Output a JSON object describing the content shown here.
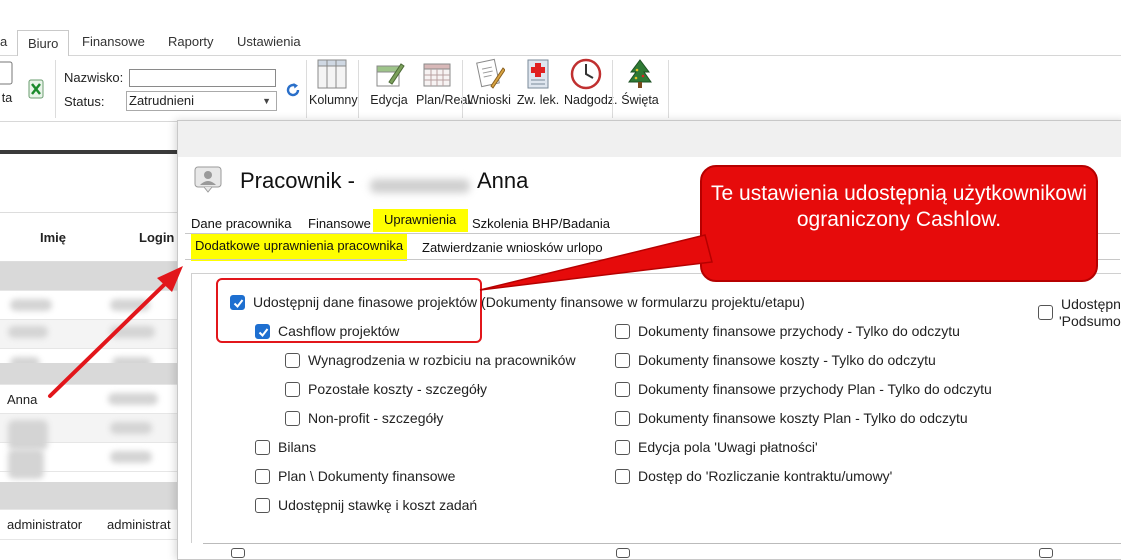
{
  "ribbon": {
    "tabs": [
      "a",
      "Biuro",
      "Finansowe",
      "Raporty",
      "Ustawienia"
    ],
    "active_tab": "Biuro",
    "left_partial_label": "ta",
    "nazwisko_label": "Nazwisko:",
    "nazwisko_value": "",
    "status_label": "Status:",
    "status_value": "Zatrudnieni",
    "buttons": {
      "kolumny": "Kolumny",
      "edycja": "Edycja",
      "plan_real": "Plan/Real.",
      "wnioski": "Wnioski",
      "zw_lek": "Zw. lek.",
      "nadgodz": "Nadgodz.",
      "swieta": "Święta"
    }
  },
  "grid": {
    "columns": [
      "Imię",
      "Login"
    ],
    "visible_cells": {
      "anna": "Anna",
      "admin_1": "administrator",
      "admin_2": "administrat"
    }
  },
  "dialog": {
    "title_prefix": "Pracownik -",
    "title_name": "Anna",
    "tabs": [
      "Dane pracownika",
      "Finansowe",
      "Uprawnienia",
      "Szkolenia BHP/Badania"
    ],
    "active_tab": "Uprawnienia",
    "subtabs": [
      "Dodatkowe uprawnienia pracownika",
      "Zatwierdzanie wniosków urlopo"
    ],
    "active_subtab": "Dodatkowe uprawnienia pracownika",
    "col1": [
      {
        "label": "Udostępnij dane finasowe projektów (Dokumenty finansowe w formularzu projektu/etapu)",
        "checked": true
      },
      {
        "label": "Cashflow projektów",
        "checked": true
      },
      {
        "label": "Wynagrodzenia w rozbiciu na pracowników",
        "checked": false
      },
      {
        "label": "Pozostałe koszty - szczegóły",
        "checked": false
      },
      {
        "label": "Non-profit - szczegóły",
        "checked": false
      },
      {
        "label": "Bilans",
        "checked": false
      },
      {
        "label": "Plan \\ Dokumenty finansowe",
        "checked": false
      },
      {
        "label": "Udostępnij stawkę i koszt zadań",
        "checked": false
      }
    ],
    "col2": [
      {
        "label": "Dokumenty finansowe przychody - Tylko do odczytu",
        "checked": false
      },
      {
        "label": "Dokumenty finansowe koszty - Tylko do odczytu",
        "checked": false
      },
      {
        "label": "Dokumenty finansowe przychody Plan - Tylko do odczytu",
        "checked": false
      },
      {
        "label": "Dokumenty finansowe koszty Plan - Tylko do odczytu",
        "checked": false
      },
      {
        "label": "Edycja pola 'Uwagi płatności'",
        "checked": false
      },
      {
        "label": "Dostęp do 'Rozliczanie kontraktu/umowy'",
        "checked": false
      }
    ],
    "col3": {
      "line1": "Udostępni",
      "line2": "'Podsumo",
      "checked": false
    }
  },
  "annotation": {
    "callout_text": "Te ustawienia udostępnią użytkownikowi ograniczony Cashlow.",
    "color": "#e60b0b"
  },
  "colors": {
    "highlight": "#ffff00",
    "checkbox_checked": "#1e6fd0",
    "annotation_red": "#e2161b"
  }
}
